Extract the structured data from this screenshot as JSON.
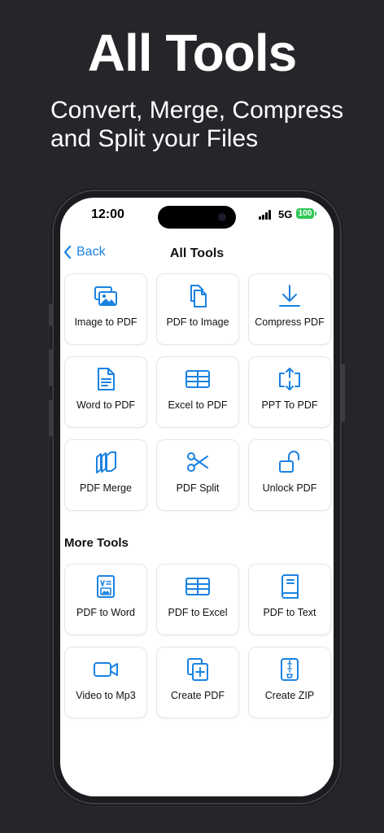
{
  "promo": {
    "title": "All Tools",
    "subtitle_line1": "Convert, Merge, Compress",
    "subtitle_line2": "and Split your Files"
  },
  "status_bar": {
    "time": "12:00",
    "network": "5G",
    "battery": "100"
  },
  "nav": {
    "back_label": "Back",
    "title": "All Tools"
  },
  "tools": [
    {
      "label": "Image to PDF",
      "icon": "images-icon"
    },
    {
      "label": "PDF to Image",
      "icon": "documents-icon"
    },
    {
      "label": "Compress PDF",
      "icon": "download-arrow-icon"
    },
    {
      "label": "Word to PDF",
      "icon": "document-text-icon"
    },
    {
      "label": "Excel to PDF",
      "icon": "table-icon"
    },
    {
      "label": "PPT To PDF",
      "icon": "expand-arrows-icon"
    },
    {
      "label": "PDF Merge",
      "icon": "stacked-pages-icon"
    },
    {
      "label": "PDF Split",
      "icon": "scissors-icon"
    },
    {
      "label": "Unlock PDF",
      "icon": "unlock-icon"
    }
  ],
  "more_tools_heading": "More Tools",
  "more_tools": [
    {
      "label": "PDF to Word",
      "icon": "word-doc-icon"
    },
    {
      "label": "PDF to Excel",
      "icon": "table-icon"
    },
    {
      "label": "PDF to Text",
      "icon": "book-icon"
    },
    {
      "label": "Video to Mp3",
      "icon": "video-camera-icon"
    },
    {
      "label": "Create PDF",
      "icon": "add-document-icon"
    },
    {
      "label": "Create ZIP",
      "icon": "zip-file-icon"
    }
  ],
  "colors": {
    "accent": "#1a82e2",
    "background": "#24262a",
    "screen": "#ffffff"
  }
}
